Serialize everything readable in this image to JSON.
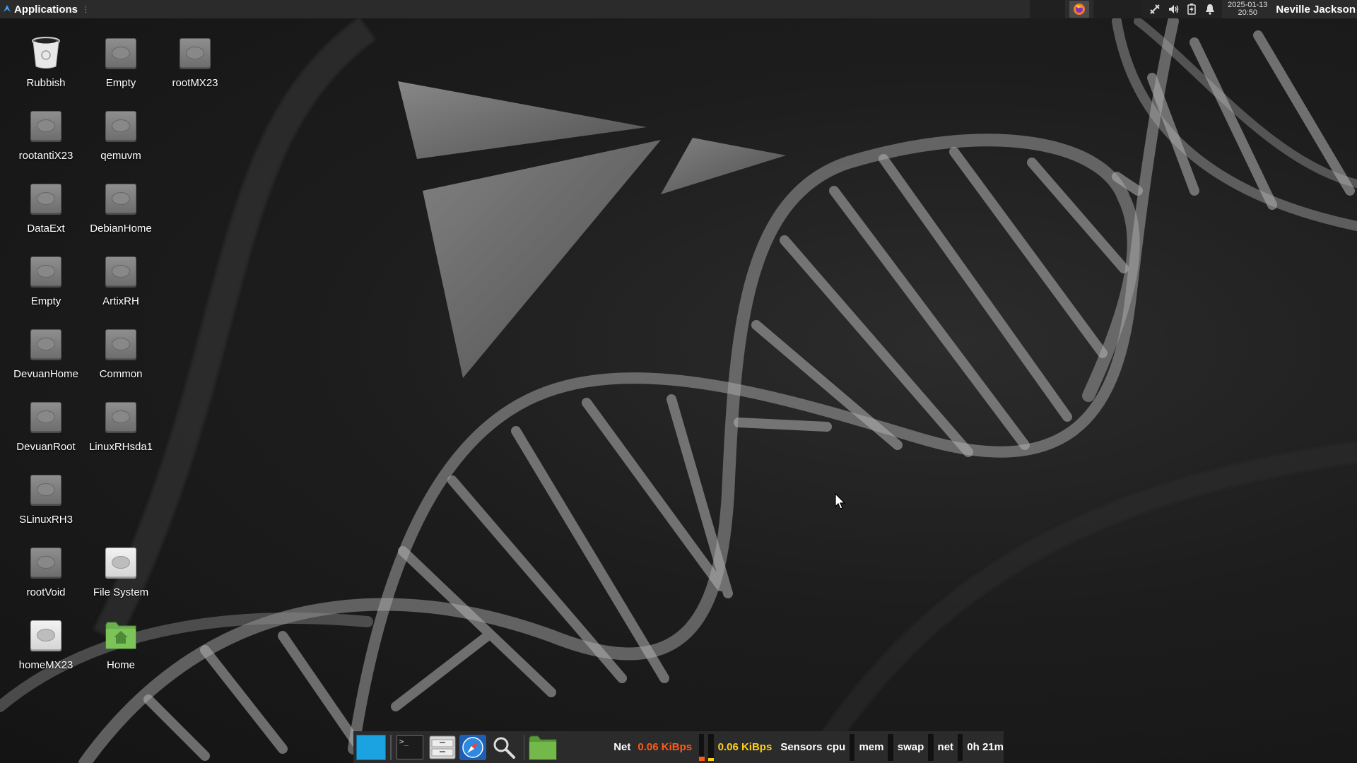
{
  "top_panel": {
    "applications_label": "Applications",
    "clock": {
      "date": "2025-01-13",
      "time": "20:50"
    },
    "user": "Neville Jackson",
    "tray_icons": [
      "network-icon",
      "volume-icon",
      "battery-icon",
      "notification-bell-icon"
    ],
    "launcher_icons": [
      "firefox-icon"
    ]
  },
  "desktop": {
    "icons": [
      {
        "label": "Rubbish",
        "icon": "trash-icon"
      },
      {
        "label": "Empty",
        "icon": "drive-icon"
      },
      {
        "label": "rootMX23",
        "icon": "drive-icon"
      },
      {
        "label": "rootantiX23",
        "icon": "drive-icon"
      },
      {
        "label": "qemuvm",
        "icon": "drive-icon"
      },
      {
        "label": "DataExt",
        "icon": "drive-icon"
      },
      {
        "label": "DebianHome",
        "icon": "drive-icon"
      },
      {
        "label": "Empty",
        "icon": "drive-icon"
      },
      {
        "label": "ArtixRH",
        "icon": "drive-icon"
      },
      {
        "label": "DevuanHome",
        "icon": "drive-icon"
      },
      {
        "label": "Common",
        "icon": "drive-icon"
      },
      {
        "label": "DevuanRoot",
        "icon": "drive-icon"
      },
      {
        "label": "LinuxRHsda1",
        "icon": "drive-icon"
      },
      {
        "label": "SLinuxRH3",
        "icon": "drive-icon"
      },
      {
        "label": "rootVoid",
        "icon": "drive-icon"
      },
      {
        "label": "File System",
        "icon": "drive-icon-light"
      },
      {
        "label": "homeMX23",
        "icon": "drive-icon-light"
      },
      {
        "label": "Home",
        "icon": "home-folder-icon"
      }
    ]
  },
  "dock": {
    "launchers": [
      "show-desktop-icon",
      "terminal-icon",
      "file-manager-icon",
      "web-browser-icon",
      "search-icon",
      "folder-icon"
    ],
    "net_label": "Net",
    "net_down": "0.06 KiBps",
    "net_up": "0.06 KiBps",
    "sensors_label": "Sensors",
    "cpu_label": "cpu",
    "mem_label": "mem",
    "swap_label": "swap",
    "net_graph_label": "net",
    "uptime": "0h 21m",
    "colors": {
      "net_down": "#ff5a1a",
      "net_up": "#ffd21a",
      "accent": "#1aa3e0"
    }
  }
}
